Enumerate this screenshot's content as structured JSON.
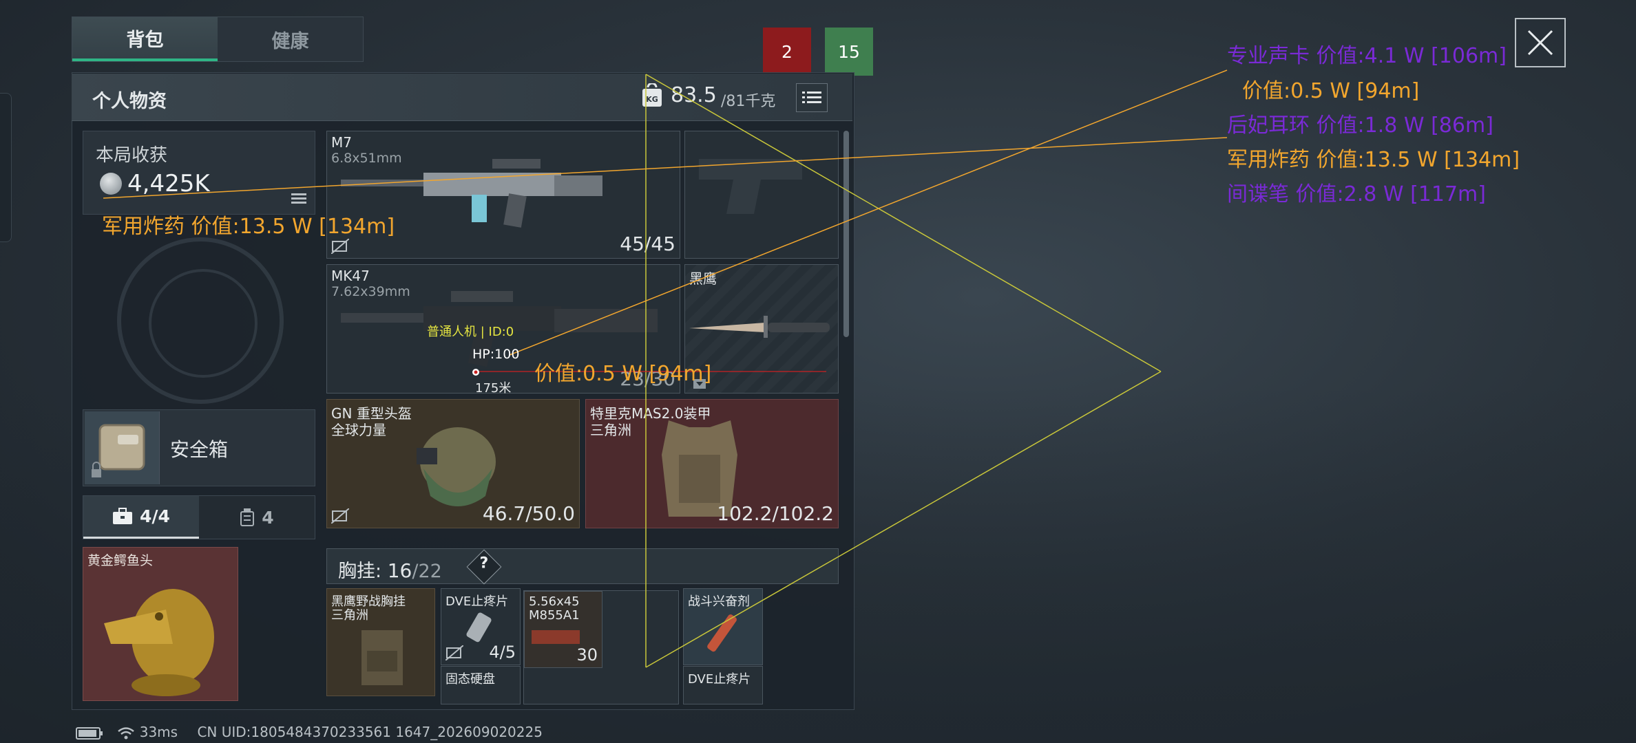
{
  "tabs": [
    "背包",
    "健康"
  ],
  "badges": {
    "red": "2",
    "green": "15"
  },
  "header": {
    "title": "个人物资",
    "weight_current": "83.5",
    "weight_max": "/81千克"
  },
  "earnings": {
    "label": "本局收获",
    "value": "4,425K"
  },
  "safe_box": {
    "label": "安全箱"
  },
  "sub_tabs": [
    {
      "label": "4/4",
      "icon": "briefcase-icon"
    },
    {
      "label": "4",
      "icon": "canister-icon"
    }
  ],
  "items": {
    "croc_head": "黄金鳄鱼头",
    "m7": {
      "name": "M7",
      "caliber": "6.8x51mm",
      "ammo": "45/45"
    },
    "mk47": {
      "name": "MK47",
      "caliber": "7.62x39mm",
      "ammo": "23/30"
    },
    "knife": {
      "name": "黑鹰"
    },
    "helmet": {
      "name": "GN 重型头盔",
      "sub": "全球力量",
      "durability": "46.7/50.0"
    },
    "armor": {
      "name": "特里克MAS2.0装甲",
      "sub": "三角洲",
      "durability": "102.2/102.2"
    },
    "rig": {
      "name": "黑鹰野战胸挂",
      "sub": "三角洲"
    },
    "dve1": {
      "name": "DVE止疼片",
      "count": "4/5"
    },
    "ammo": {
      "name": "5.56x45",
      "sub": "M855A1",
      "count": "30"
    },
    "stim": {
      "name": "战斗兴奋剂"
    },
    "ssd": {
      "name": "固态硬盘"
    },
    "dve2": {
      "name": "DVE止疼片"
    }
  },
  "chest": {
    "label": "胸挂:",
    "current": "16",
    "max": "/22",
    "help": "?"
  },
  "overlay": {
    "list": [
      {
        "text": "专业声卡   价值:4.1 W [106m]",
        "color": "#7a2ad6"
      },
      {
        "text": "价值:0.5 W [94m]",
        "color": "#f2a62e"
      },
      {
        "text": "后妃耳环   价值:1.8 W [86m]",
        "color": "#7a2ad6"
      },
      {
        "text": "军用炸药   价值:13.5 W [134m]",
        "color": "#f2a62e"
      },
      {
        "text": "间谍笔   价值:2.8 W [117m]",
        "color": "#7a2ad6"
      }
    ],
    "left_label": "军用炸药   价值:13.5 W [134m]",
    "center_label": "价值:0.5 W [94m]",
    "enemy_tag": "普通人机 | ID:0",
    "enemy_hp": "HP:100",
    "enemy_dist": "175米"
  },
  "status": {
    "ping": "33ms",
    "uid": "CN UID:1805484370233561 1647_202609020225"
  }
}
